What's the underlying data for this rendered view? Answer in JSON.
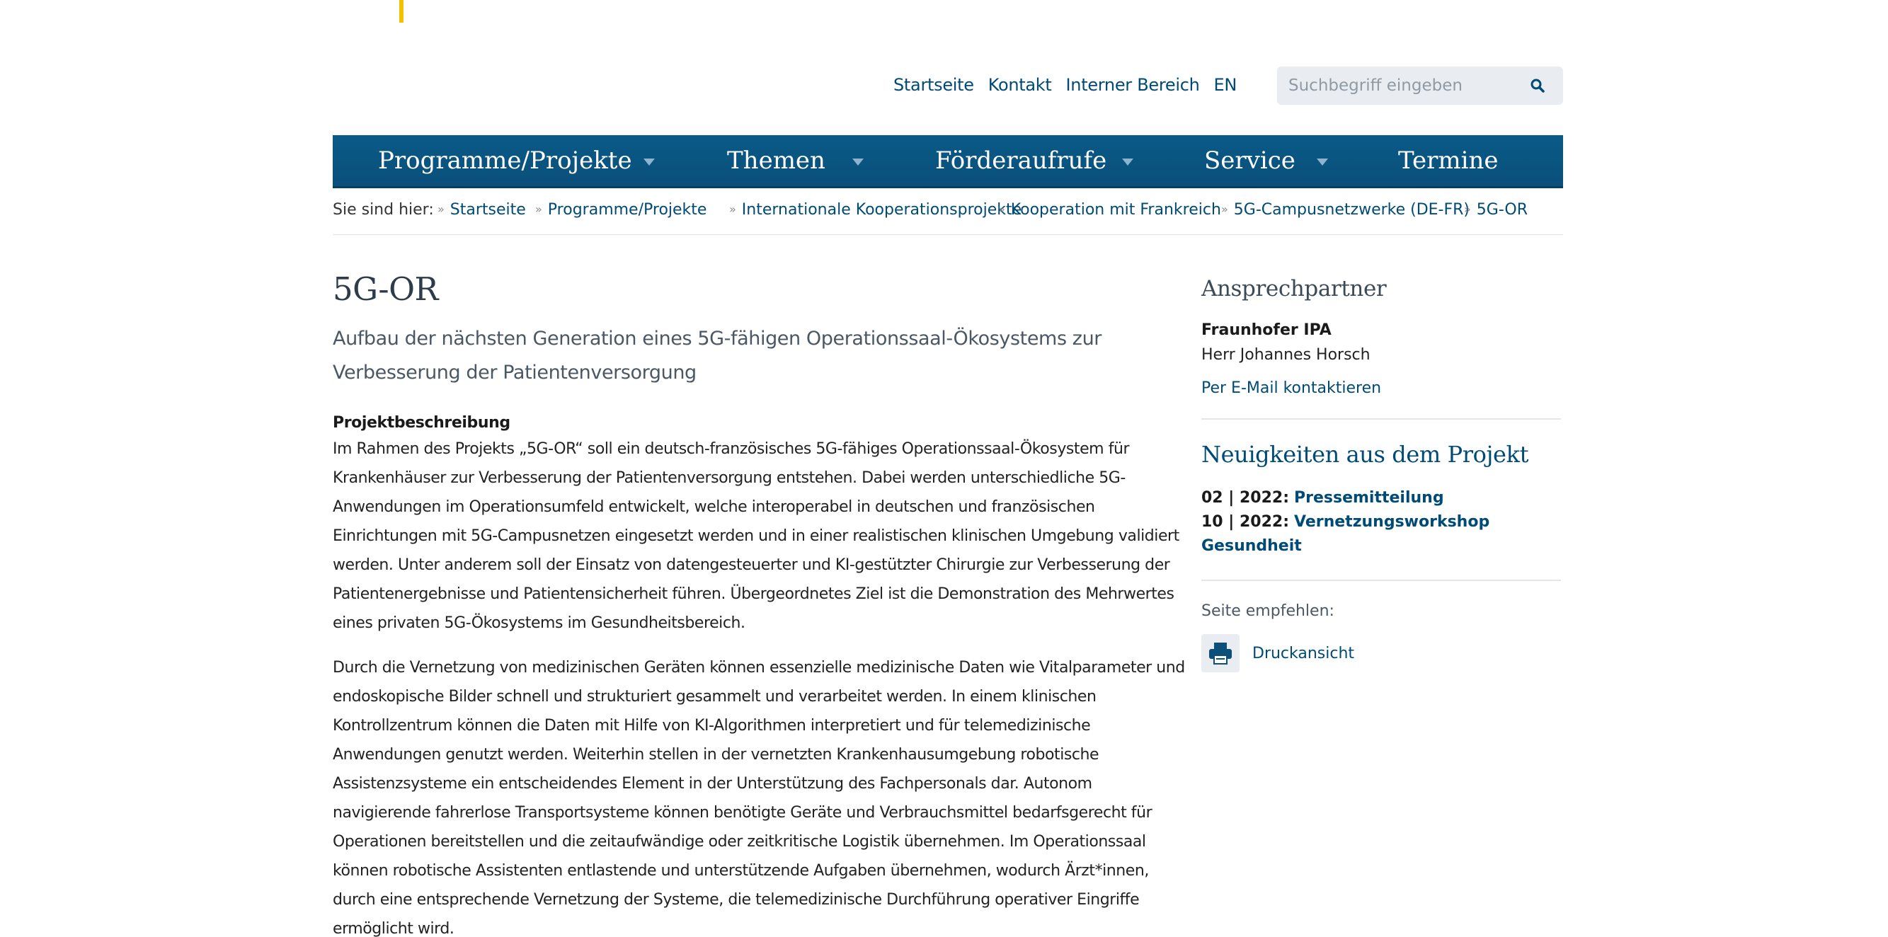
{
  "meta_nav": {
    "items": [
      "Startseite",
      "Kontakt",
      "Interner Bereich",
      "EN"
    ]
  },
  "search": {
    "placeholder": "Suchbegriff eingeben",
    "icon": "search-icon"
  },
  "main_nav": {
    "items": [
      {
        "label": "Programme/Projekte",
        "has_dropdown": true
      },
      {
        "label": "Themen",
        "has_dropdown": true
      },
      {
        "label": "Förderaufrufe",
        "has_dropdown": true
      },
      {
        "label": "Service",
        "has_dropdown": true
      },
      {
        "label": "Termine",
        "has_dropdown": false
      }
    ]
  },
  "breadcrumb": {
    "lead": "Sie sind hier:",
    "items": [
      "Startseite",
      "Programme/Projekte",
      "Internationale Kooperationsprojekte",
      "Kooperation mit Frankreich",
      "5G-Campusnetzwerke (DE-FR)",
      "5G-OR"
    ]
  },
  "main": {
    "title": "5G-OR",
    "subtitle": "Aufbau der nächsten Generation eines 5G-fähigen Operationssaal-Ökosystems zur Verbesserung der Patientenversorgung",
    "section_heading": "Projektbeschreibung",
    "paragraph_1": "Im Rahmen des Projekts „5G-OR“ soll ein deutsch-französisches 5G-fähiges Operationssaal-Ökosystem für Krankenhäuser zur Verbesserung der Patientenversorgung entstehen. Dabei werden unterschiedliche 5G-Anwendungen im Operationsumfeld entwickelt, welche interoperabel in deutschen und französischen Einrichtungen mit 5G-Campusnetzen eingesetzt werden und in einer realistischen klinischen Umgebung validiert werden. Unter anderem soll der Einsatz von datengesteuerter und KI-gestützter Chirurgie zur Verbesserung der Patientenergebnisse und Patientensicherheit führen. Übergeordnetes Ziel ist die Demonstration des Mehrwertes eines privaten 5G-Ökosystems im Gesundheitsbereich.",
    "paragraph_2": "Durch die Vernetzung von medizinischen Geräten können essenzielle medizinische Daten wie Vitalparameter und endoskopische Bilder schnell und strukturiert gesammelt und verarbeitet werden. In einem klinischen Kontrollzentrum können die Daten mit Hilfe von KI-Algorithmen interpretiert und für telemedizinische Anwendungen genutzt werden. Weiterhin stellen in der vernetzten Krankenhausumgebung robotische Assistenzsysteme ein entscheidendes Element in der Unterstützung des Fachpersonals dar. Autonom navigierende fahrerlose Transportsysteme können benötigte Geräte und Verbrauchsmittel bedarfsgerecht für Operationen bereitstellen und die zeitaufwändige oder zeitkritische Logistik übernehmen. Im Operationssaal können robotische Assistenten entlastende und unterstützende Aufgaben übernehmen, wodurch Ärzt*innen, durch eine entsprechende Vernetzung der Systeme, die telemedizinische Durchführung operativer Eingriffe ermöglicht wird."
  },
  "sidebar": {
    "contact_heading": "Ansprechpartner",
    "contact_org": "Fraunhofer IPA",
    "contact_person": "Herr Johannes Horsch",
    "contact_link": "Per E-Mail kontaktieren",
    "news_heading": "Neuigkeiten aus dem Projekt",
    "news": [
      {
        "date": "02 | 2022:",
        "label": "Pressemitteilung"
      },
      {
        "date": "10 | 2022:",
        "label": "Vernetzungsworkshop Gesundheit"
      }
    ],
    "recommend_label": "Seite empfehlen:",
    "print_label": "Druckansicht",
    "print_icon": "printer-icon"
  },
  "colors": {
    "brand_blue": "#004b76",
    "nav_bg": "#0b5580",
    "logo_yellow": "#f2c200"
  }
}
